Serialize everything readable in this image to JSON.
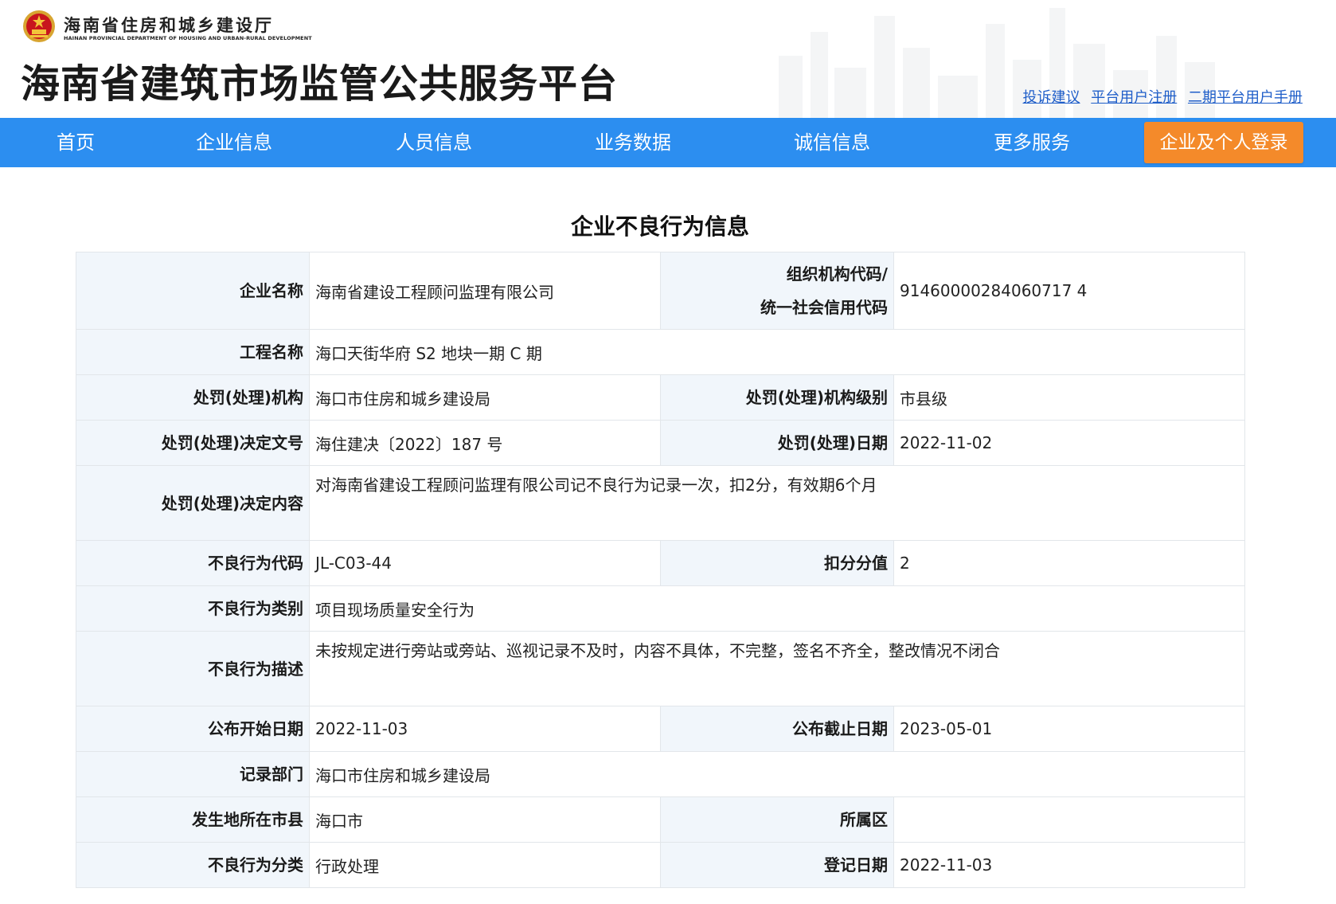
{
  "header": {
    "dept_name_cn": "海南省住房和城乡建设厅",
    "dept_name_en": "HAINAN PROVINCIAL DEPARTMENT OF HOUSING AND URBAN-RURAL DEVELOPMENT",
    "site_title": "海南省建筑市场监管公共服务平台",
    "emblem_icon": "national-emblem-icon",
    "links": [
      "投诉建议",
      "平台用户注册",
      "二期平台用户手册"
    ]
  },
  "nav": {
    "items": [
      "首页",
      "企业信息",
      "人员信息",
      "业务数据",
      "诚信信息",
      "更多服务"
    ],
    "login_label": "企业及个人登录",
    "color": "#2c8ef0",
    "login_color": "#f48a2a"
  },
  "page_title": "企业不良行为信息",
  "record": {
    "company_name_label": "企业名称",
    "company_name": "海南省建设工程顾问监理有限公司",
    "org_code_label_line1": "组织机构代码/",
    "org_code_label_line2": "统一社会信用代码",
    "org_code": "91460000284060717 4",
    "project_name_label": "工程名称",
    "project_name": "海口天街华府 S2 地块一期 C 期",
    "authority_label": "处罚(处理)机构",
    "authority": "海口市住房和城乡建设局",
    "authority_level_label": "处罚(处理)机构级别",
    "authority_level": "市县级",
    "decision_no_label": "处罚(处理)决定文号",
    "decision_no": "海住建决〔2022〕187 号",
    "decision_date_label": "处罚(处理)日期",
    "decision_date": "2022-11-02",
    "decision_content_label": "处罚(处理)决定内容",
    "decision_content": "对海南省建设工程顾问监理有限公司记不良行为记录一次，扣2分，有效期6个月",
    "behavior_code_label": "不良行为代码",
    "behavior_code": "JL-C03-44",
    "deduction_label": "扣分分值",
    "deduction": "2",
    "behavior_category_label": "不良行为类别",
    "behavior_category": "项目现场质量安全行为",
    "behavior_desc_label": "不良行为描述",
    "behavior_desc": "未按规定进行旁站或旁站、巡视记录不及时，内容不具体，不完整，签名不齐全，整改情况不闭合",
    "publish_start_label": "公布开始日期",
    "publish_start": "2022-11-03",
    "publish_end_label": "公布截止日期",
    "publish_end": "2023-05-01",
    "record_dept_label": "记录部门",
    "record_dept": "海口市住房和城乡建设局",
    "city_label": "发生地所在市县",
    "city": "海口市",
    "district_label": "所属区",
    "district": "",
    "classification_label": "不良行为分类",
    "classification": "行政处理",
    "register_date_label": "登记日期",
    "register_date": "2022-11-03"
  }
}
